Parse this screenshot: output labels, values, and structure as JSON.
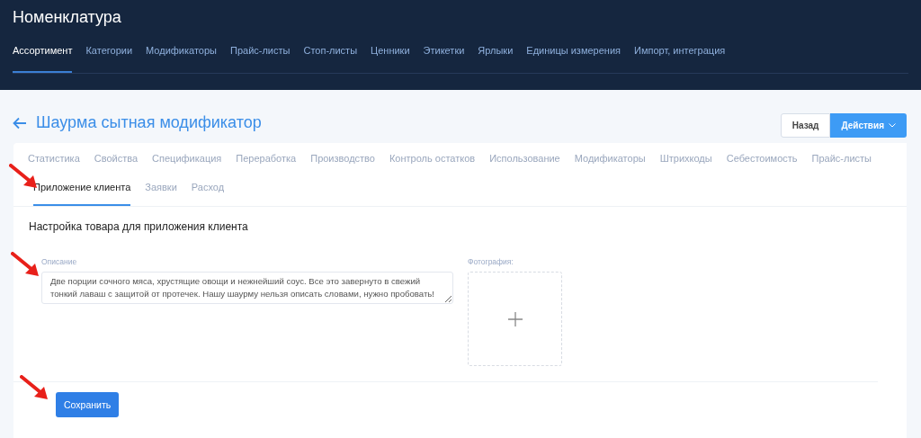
{
  "header": {
    "title": "Номенклатура",
    "nav": [
      {
        "label": "Ассортимент",
        "selected": true
      },
      {
        "label": "Категории",
        "selected": false
      },
      {
        "label": "Модификаторы",
        "selected": false
      },
      {
        "label": "Прайс-листы",
        "selected": false
      },
      {
        "label": "Стоп-листы",
        "selected": false
      },
      {
        "label": "Ценники",
        "selected": false
      },
      {
        "label": "Этикетки",
        "selected": false
      },
      {
        "label": "Ярлыки",
        "selected": false
      },
      {
        "label": "Единицы измерения",
        "selected": false
      },
      {
        "label": "Импорт, интеграция",
        "selected": false
      }
    ]
  },
  "page": {
    "title": "Шаурма сытная модификатор",
    "buttons": {
      "back": "Назад",
      "actions": "Действия"
    }
  },
  "tabs": [
    [
      {
        "label": "Статистика",
        "selected": false
      },
      {
        "label": "Свойства",
        "selected": false
      },
      {
        "label": "Спецификация",
        "selected": false
      },
      {
        "label": "Переработка",
        "selected": false
      },
      {
        "label": "Производство",
        "selected": false
      },
      {
        "label": "Контроль остатков",
        "selected": false
      },
      {
        "label": "Использование",
        "selected": false
      },
      {
        "label": "Модификаторы",
        "selected": false
      },
      {
        "label": "Штрихкоды",
        "selected": false
      },
      {
        "label": "Себестоимость",
        "selected": false
      },
      {
        "label": "Прайс-листы",
        "selected": false
      }
    ],
    [
      {
        "label": "Приложение клиента",
        "selected": true
      },
      {
        "label": "Заявки",
        "selected": false
      },
      {
        "label": "Расход",
        "selected": false
      }
    ]
  ],
  "form": {
    "heading": "Настройка товара для приложения клиента",
    "description": {
      "label": "Описание",
      "value": "Две порции сочного мяса, хрустящие овощи и нежнейший соус. Все это завернуто в свежий тонкий лаваш с защитой от протечек. Нашу шаурму нельзя описать словами, нужно пробовать!"
    },
    "photo": {
      "label": "Фотография:"
    },
    "save": "Сохранить"
  }
}
